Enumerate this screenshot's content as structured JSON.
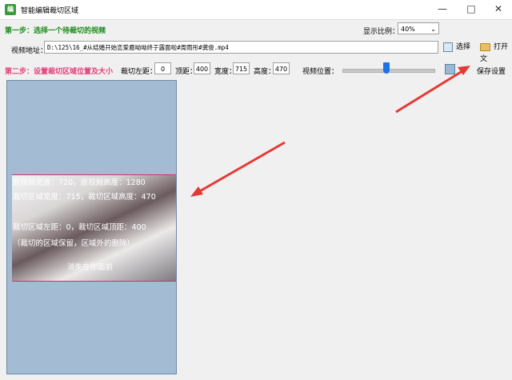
{
  "window": {
    "title": "智能编辑裁切区域",
    "app_icon_text": "编"
  },
  "step1": {
    "label": "第一步：选择一个待裁切的视频",
    "ratio_label": "显示比例：",
    "ratio_value": "40%"
  },
  "video": {
    "path_label": "视频地址：",
    "path_value": "D:\\125\\16_#从结婚开始恋爱鹿呦呦终于露面啦#周雨彤#龚俊.mp4",
    "select_button": "选择",
    "open_button": "打开文"
  },
  "step2": {
    "label": "第二步：设置裁切区域位置及大小",
    "left_label": "裁切左距：",
    "left_value": "0",
    "top_label": "顶距：",
    "top_value": "400",
    "width_label": "宽度：",
    "width_value": "715",
    "height_label": "高度：",
    "height_value": "470",
    "position_label": "视频位置：",
    "save_button": "保存设置"
  },
  "preview": {
    "line1": "原视频宽度：720，原视频高度：1280",
    "line2": "裁切区域宽度：715，裁切区域高度：470",
    "line3": "裁切区域左距：0，裁切区域顶距：400",
    "line4": "（裁切的区域保留，区域外的删除）",
    "subtitle": "消失在你面前"
  },
  "colors": {
    "step1": "#1b8a1b",
    "step2": "#e0407a",
    "preview_bg": "#a3bcd3",
    "arrow": "#e53935"
  }
}
